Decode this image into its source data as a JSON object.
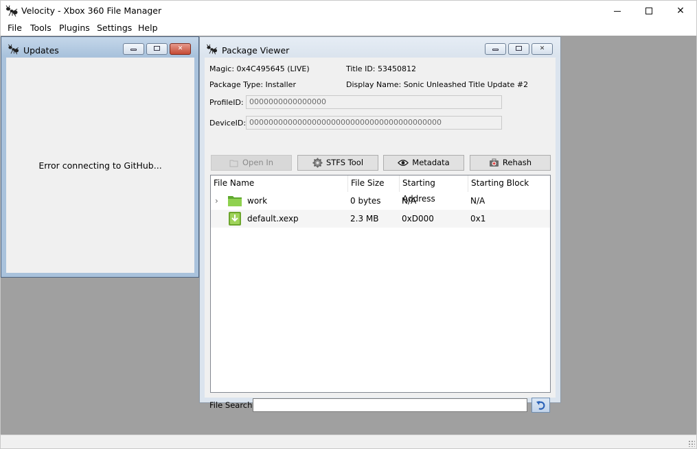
{
  "app": {
    "title": "Velocity - Xbox 360 File Manager",
    "icon": "ant-icon"
  },
  "window_controls": {
    "minimize_icon": "minimize-icon",
    "maximize_icon": "maximize-icon",
    "close_icon": "close-icon",
    "close_glyph": "✕"
  },
  "menu": [
    "File",
    "Tools",
    "Plugins",
    "Settings",
    "Help"
  ],
  "updates": {
    "title": "Updates",
    "message": "Error connecting to GitHub...",
    "close_glyph": "✕"
  },
  "package_viewer": {
    "title": "Package Viewer",
    "magic": "Magic: 0x4C495645 (LIVE)",
    "title_id": "Title ID: 53450812",
    "package_type": "Package Type: Installer",
    "display_name": "Display Name: Sonic Unleashed Title Update #2",
    "profile_label": "ProfileID:",
    "profile_value": "0000000000000000",
    "device_label": "DeviceID:",
    "device_value": "0000000000000000000000000000000000000000",
    "close_glyph": "✕",
    "buttons": {
      "open_in": "Open In",
      "stfs_tool": "STFS Tool",
      "metadata": "Metadata",
      "rehash": "Rehash"
    },
    "columns": [
      "File Name",
      "File Size",
      "Starting Address",
      "Starting Block"
    ],
    "rows": [
      {
        "name": "work",
        "size": "0 bytes",
        "address": "N/A",
        "block": "N/A",
        "expander": "›",
        "icon": "folder-icon"
      },
      {
        "name": "default.xexp",
        "size": "2.3 MB",
        "address": "0xD000",
        "block": "0x1",
        "expander": "",
        "icon": "xex-file-icon"
      }
    ],
    "search_label": "File Search:",
    "search_value": ""
  },
  "colors": {
    "mdi_background": "#a0a0a0",
    "active_subwindow_frame": "#a9c2dc",
    "inactive_subwindow_frame": "#dbe4ee",
    "folder_green": "#7cc242"
  }
}
